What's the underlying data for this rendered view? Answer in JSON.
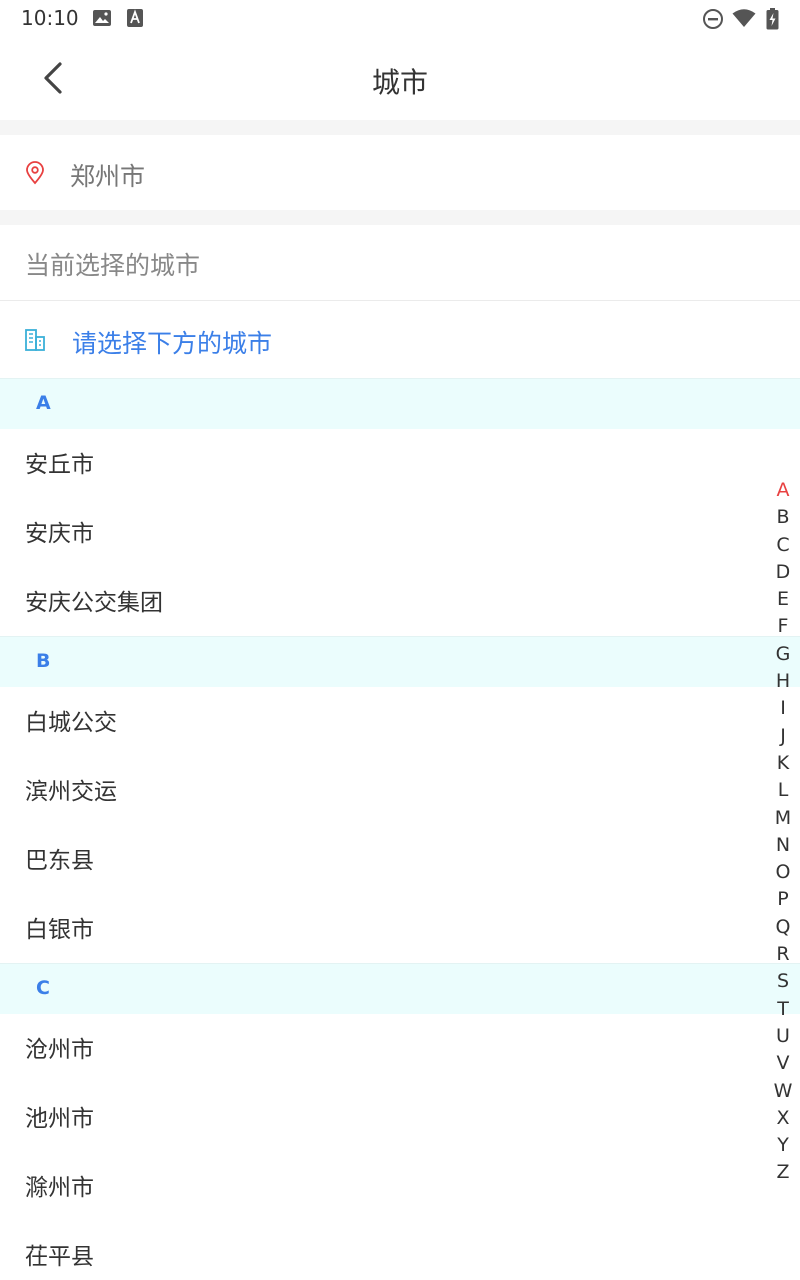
{
  "status_bar": {
    "time": "10:10",
    "left_icons": [
      "image-icon",
      "font-a-icon"
    ],
    "right_icons": [
      "do-not-disturb-icon",
      "wifi-icon",
      "battery-charging-icon"
    ]
  },
  "header": {
    "back_icon": "chevron-left-icon",
    "title": "城市"
  },
  "location": {
    "icon": "location-pin-icon",
    "city": "郑州市",
    "icon_color": "#e84040"
  },
  "current_selection": {
    "label": "当前选择的城市",
    "icon": "building-icon",
    "value": "请选择下方的城市",
    "accent_color": "#3b7fe8"
  },
  "city_sections": [
    {
      "letter": "A",
      "cities": [
        "安丘市",
        "安庆市",
        "安庆公交集团"
      ]
    },
    {
      "letter": "B",
      "cities": [
        "白城公交",
        "滨州交运",
        "巴东县",
        "白银市"
      ]
    },
    {
      "letter": "C",
      "cities": [
        "沧州市",
        "池州市",
        "滁州市",
        "茌平县"
      ]
    }
  ],
  "alphabet_index": {
    "active": "A",
    "active_color": "#e84040",
    "letters": [
      "A",
      "B",
      "C",
      "D",
      "E",
      "F",
      "G",
      "H",
      "I",
      "J",
      "K",
      "L",
      "M",
      "N",
      "O",
      "P",
      "Q",
      "R",
      "S",
      "T",
      "U",
      "V",
      "W",
      "X",
      "Y",
      "Z"
    ]
  }
}
